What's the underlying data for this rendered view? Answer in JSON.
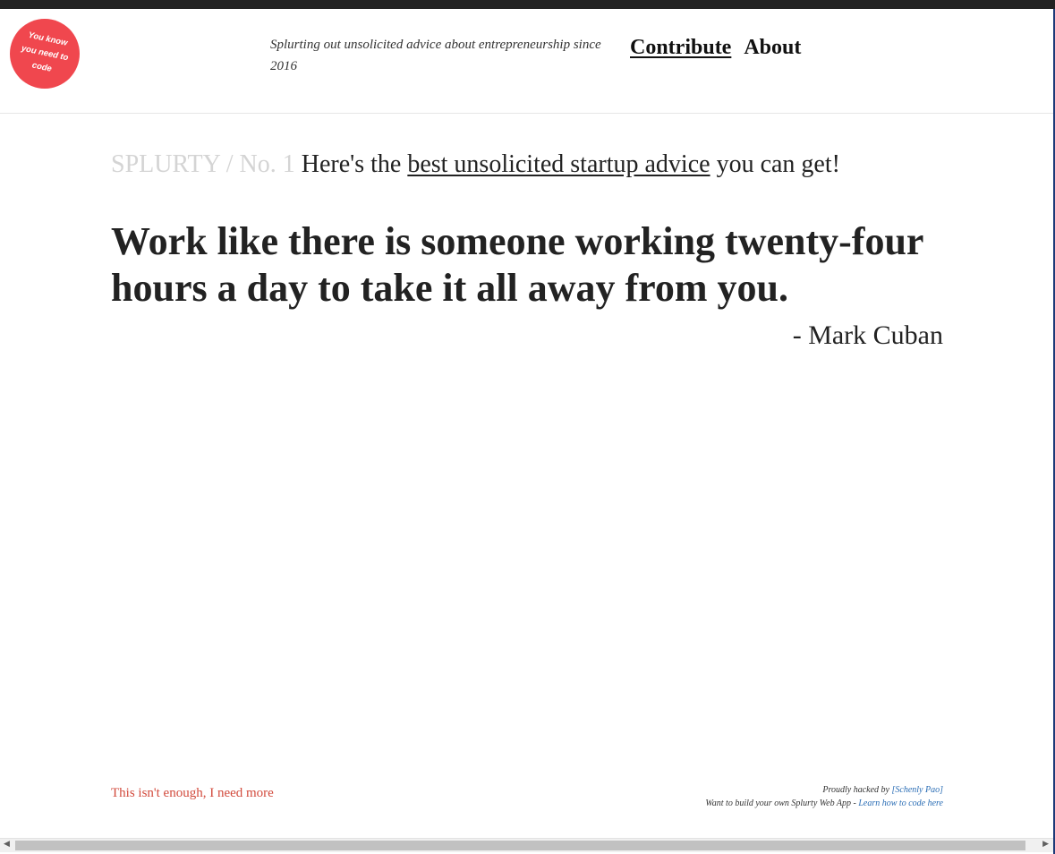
{
  "header": {
    "logo_text": "You know you need to code",
    "tagline": "Splurting out unsolicited advice about entrepreneurship since 2016",
    "nav": {
      "contribute": "Contribute",
      "about": "About"
    }
  },
  "main": {
    "breadcrumb": "SPLURTY / No. 1",
    "intro_before": "Here's the",
    "intro_link": "best unsolicited startup advice",
    "intro_after": "you can get!",
    "quote": "Work like there is someone working twenty-four hours a day to take it all away from you.",
    "author": "- Mark Cuban"
  },
  "footer": {
    "more_link": "This isn't enough, I need more",
    "credit_prefix": "Proudly hacked by",
    "credit_name": "[Schenly Pao]",
    "build_prefix": "Want to build your own Splurty Web App -",
    "build_link": "Learn how to code here"
  },
  "icons": {
    "scroll_left": "arrow-left-icon",
    "scroll_right": "arrow-right-icon"
  },
  "colors": {
    "logo": "#f0474e",
    "more_link": "#d24a3c",
    "credit_link": "#2a6db5",
    "topbar": "#222222"
  }
}
